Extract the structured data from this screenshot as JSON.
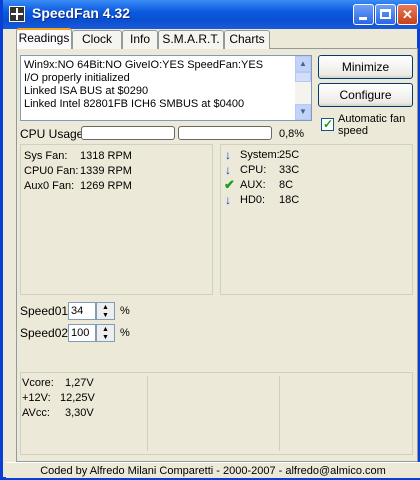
{
  "window": {
    "title": "SpeedFan 4.32",
    "minimize_glyph": "_",
    "maximize_glyph": "□",
    "close_glyph": "✕"
  },
  "tabs": [
    {
      "label": "Readings",
      "active": true
    },
    {
      "label": "Clock"
    },
    {
      "label": "Info"
    },
    {
      "label": "S.M.A.R.T."
    },
    {
      "label": "Charts"
    }
  ],
  "log": {
    "lines": [
      "Win9x:NO  64Bit:NO  GiveIO:YES  SpeedFan:YES",
      "I/O properly initialized",
      "Linked ISA BUS at $0290",
      "Linked Intel 82801FB ICH6 SMBUS at $0400"
    ]
  },
  "buttons": {
    "minimize": "Minimize",
    "configure": "Configure"
  },
  "auto_fan": {
    "label": "Automatic fan speed",
    "checked": true
  },
  "cpu": {
    "label": "CPU Usage",
    "percent_text": "0,8%",
    "usage": 0.008
  },
  "fans": [
    {
      "name": "Sys Fan:",
      "value": "1318 RPM"
    },
    {
      "name": "CPU0 Fan:",
      "value": "1339 RPM"
    },
    {
      "name": "Aux0 Fan:",
      "value": "1269 RPM"
    }
  ],
  "temps": [
    {
      "name": "System:",
      "value": "25C",
      "icon": "arrow-down-icon"
    },
    {
      "name": "CPU:",
      "value": "33C",
      "icon": "arrow-down-icon"
    },
    {
      "name": "AUX:",
      "value": "8C",
      "icon": "check-icon"
    },
    {
      "name": "HD0:",
      "value": "18C",
      "icon": "arrow-down-icon"
    }
  ],
  "speeds": [
    {
      "label": "Speed01:",
      "value": "34",
      "unit": "%"
    },
    {
      "label": "Speed02:",
      "value": "100",
      "unit": "%"
    }
  ],
  "voltages": [
    {
      "name": "Vcore:",
      "value": "1,27V"
    },
    {
      "name": "+12V:",
      "value": "12,25V"
    },
    {
      "name": "AVcc:",
      "value": "3,30V"
    }
  ],
  "status": {
    "text": "Coded by Alfredo Milani Comparetti - 2000-2007 - alfredo@almico.com"
  },
  "colors": {
    "titlebar": "#0a4fd2",
    "accent_tab": "#f6a61a",
    "arrow_blue": "#0a39c2",
    "check_green": "#1f9c1f"
  }
}
